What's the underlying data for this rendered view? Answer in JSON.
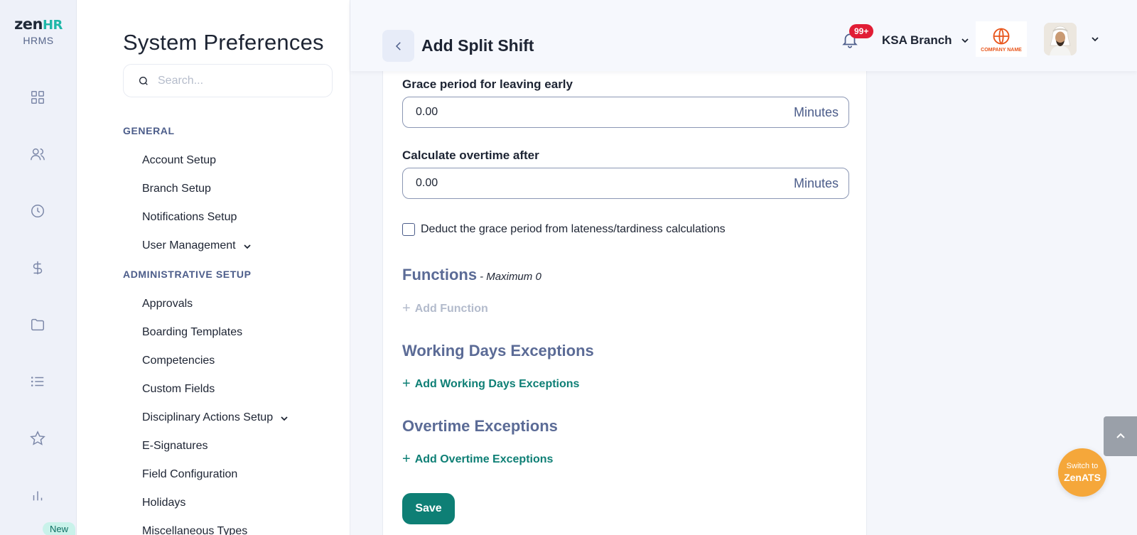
{
  "brand": {
    "word": "zen",
    "word_accent": "HR",
    "sub": "HRMS",
    "accent_color": "#1fb7a8"
  },
  "rail": {
    "icons": [
      "dashboard-icon",
      "people-icon",
      "clock-icon",
      "dollar-icon",
      "folder-icon",
      "list-icon",
      "star-icon",
      "bar-chart-icon"
    ],
    "new_badge": "New"
  },
  "settings": {
    "title": "System Preferences",
    "search_placeholder": "Search...",
    "general_label": "GENERAL",
    "general_items": [
      "Account Setup",
      "Branch Setup",
      "Notifications Setup",
      "User Management"
    ],
    "admin_label": "ADMINISTRATIVE SETUP",
    "admin_items": [
      "Approvals",
      "Boarding Templates",
      "Competencies",
      "Custom Fields",
      "Disciplinary Actions Setup",
      "E-Signatures",
      "Field Configuration",
      "Holidays",
      "Miscellaneous Types"
    ]
  },
  "header": {
    "title": "Add Split Shift",
    "notif_count": "99+",
    "branch": "KSA Branch",
    "company_logo_text": "COMPANY NAME"
  },
  "form": {
    "grace_label": "Grace period for leaving early",
    "grace_value": "0.00",
    "grace_suffix": "Minutes",
    "overtime_label": "Calculate overtime after",
    "overtime_value": "0.00",
    "overtime_suffix": "Minutes",
    "deduct_label": "Deduct the grace period from lateness/tardiness calculations",
    "functions_title": "Functions",
    "functions_max": "- Maximum 0",
    "add_function": "Add Function",
    "wde_title": "Working Days Exceptions",
    "add_wde": "Add Working Days Exceptions",
    "oe_title": "Overtime Exceptions",
    "add_oe": "Add Overtime Exceptions",
    "save": "Save"
  },
  "floating": {
    "switch_line1": "Switch to",
    "switch_line2": "ZenATS"
  },
  "colors": {
    "primary": "#0e7f75",
    "badge": "#e11d35",
    "ats": "#f5a73a"
  }
}
